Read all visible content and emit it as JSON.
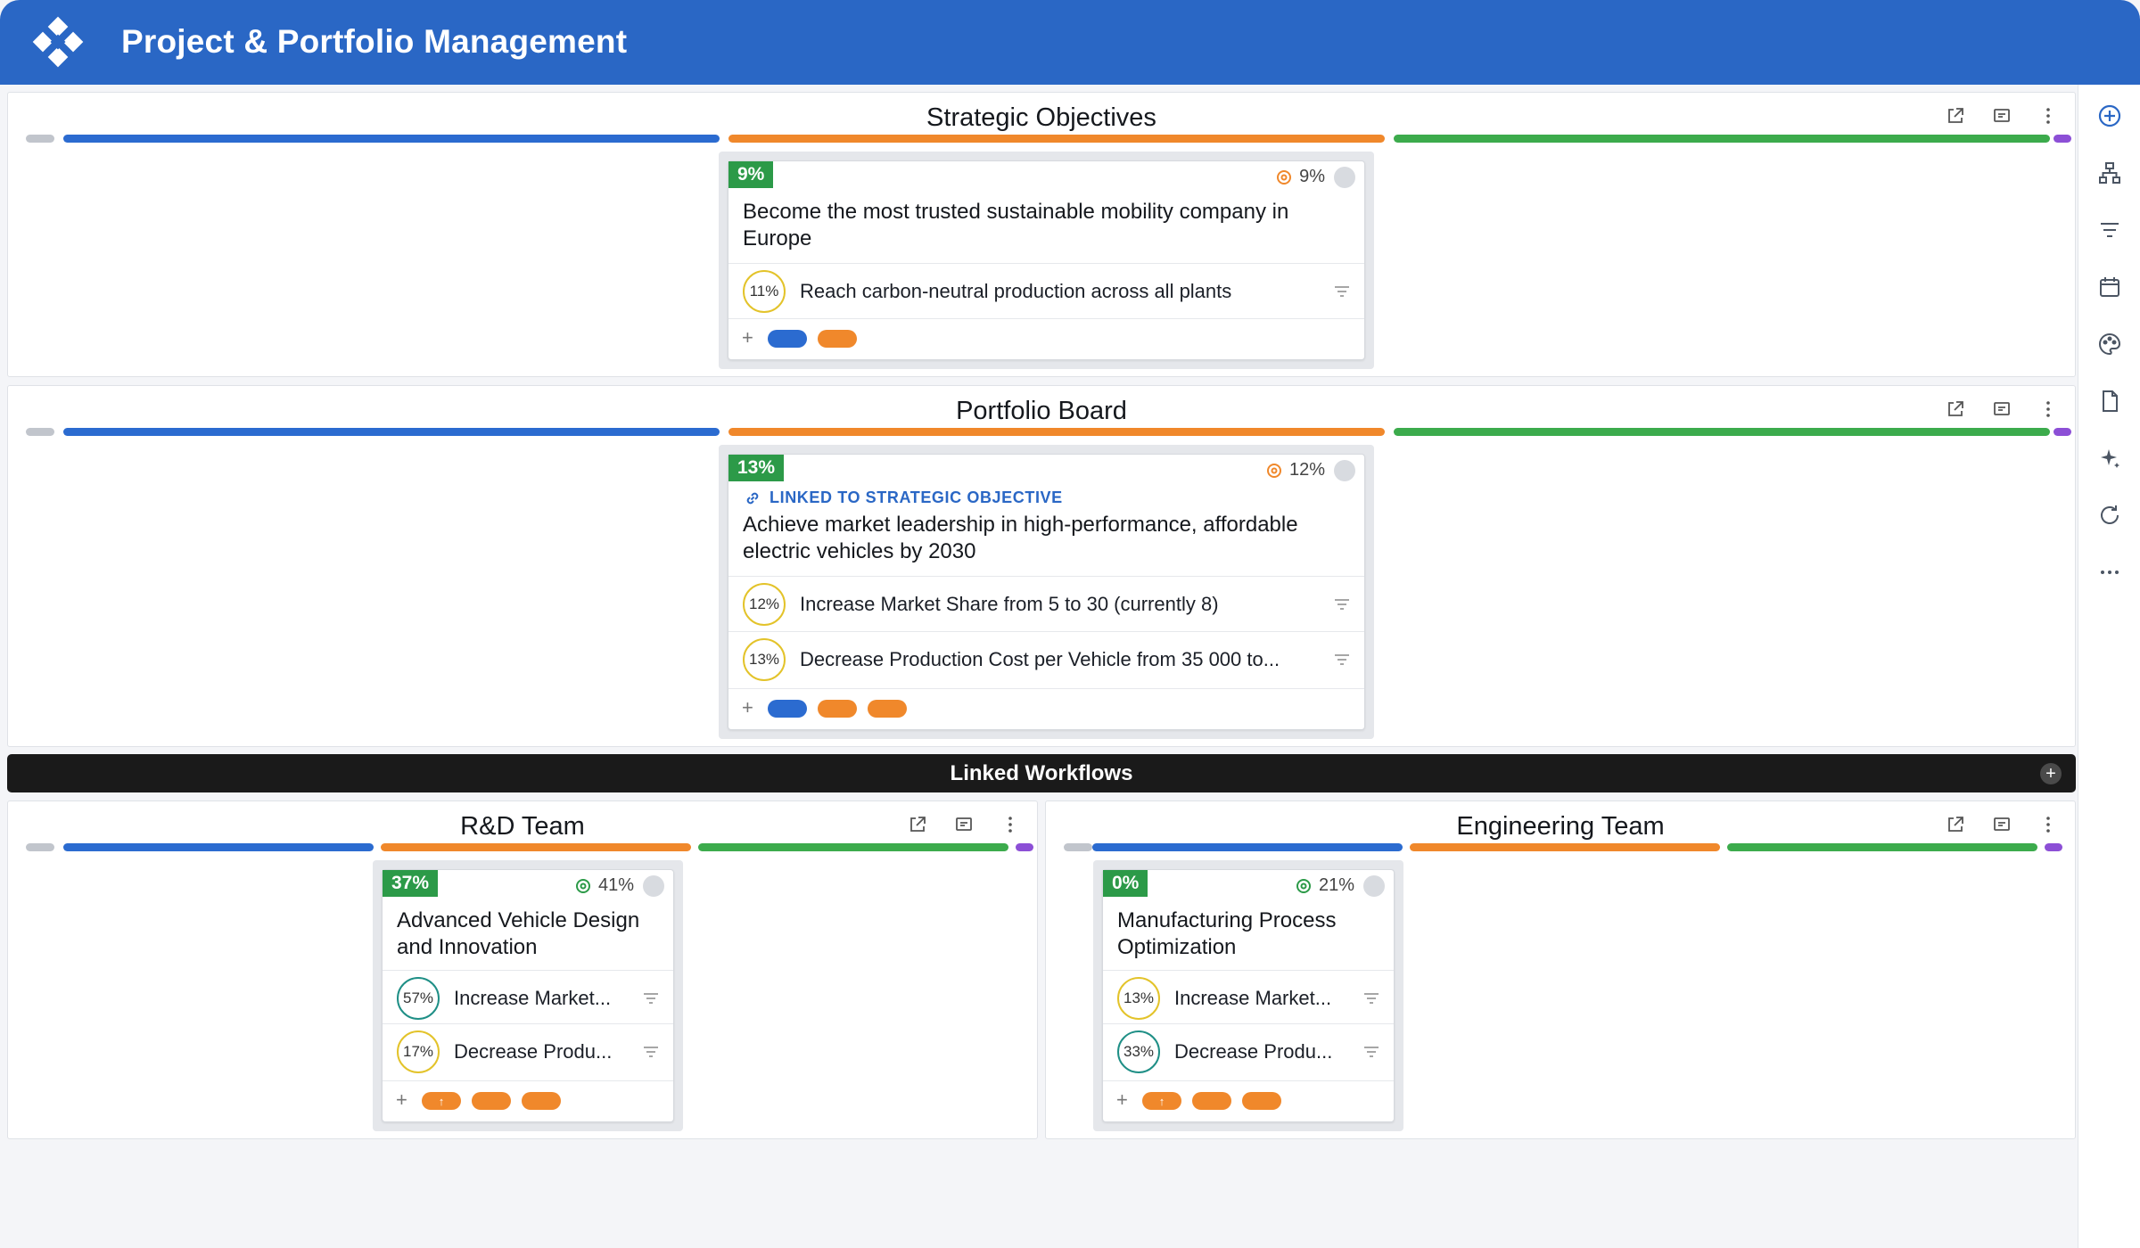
{
  "header": {
    "title": "Project & Portfolio Management"
  },
  "colors": {
    "header": "#2a67c5",
    "lane_gray": "#c1c5cc",
    "lane_blue": "#2b6bd0",
    "lane_orange": "#f0882b",
    "lane_green": "#3cab4c",
    "lane_purple": "#8c4fd6",
    "badge_green": "#2c9a48"
  },
  "rail": {
    "icons": [
      "add-circle-icon",
      "hierarchy-icon",
      "filter-icon",
      "calendar-icon",
      "palette-icon",
      "document-icon",
      "sparkle-icon",
      "refresh-icon",
      "more-horizontal-icon"
    ]
  },
  "strategic": {
    "title": "Strategic Objectives",
    "card": {
      "badge": "9%",
      "target": "9%",
      "title": "Become the most trusted sustainable mobility company in Europe",
      "krs": [
        {
          "pct": "11%",
          "text": "Reach carbon-neutral production across all plants"
        }
      ],
      "plus": "+"
    }
  },
  "portfolio": {
    "title": "Portfolio Board",
    "card": {
      "badge": "13%",
      "target": "12%",
      "linked": "LINKED TO STRATEGIC OBJECTIVE",
      "title": "Achieve market leadership in high-performance, affordable electric vehicles by 2030",
      "krs": [
        {
          "pct": "12%",
          "text": "Increase Market Share from 5 to 30 (currently 8)"
        },
        {
          "pct": "13%",
          "text": "Decrease Production Cost per Vehicle from 35 000 to..."
        }
      ],
      "plus": "+"
    }
  },
  "workflows": {
    "title": "Linked Workflows",
    "add": "+"
  },
  "rnd": {
    "title": "R&D Team",
    "card": {
      "badge": "37%",
      "target": "41%",
      "title": "Advanced Vehicle Design and Innovation",
      "krs": [
        {
          "pct": "57%",
          "text": "Increase Market..."
        },
        {
          "pct": "17%",
          "text": "Decrease Produ..."
        }
      ],
      "plus": "+",
      "pill_arrow": "↑"
    }
  },
  "engineering": {
    "title": "Engineering Team",
    "card": {
      "badge": "0%",
      "target": "21%",
      "title": "Manufacturing Process Optimization",
      "krs": [
        {
          "pct": "13%",
          "text": "Increase Market..."
        },
        {
          "pct": "33%",
          "text": "Decrease Produ..."
        }
      ],
      "plus": "+",
      "pill_arrow": "↑"
    }
  }
}
